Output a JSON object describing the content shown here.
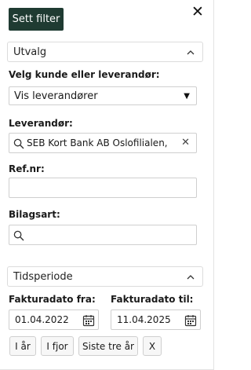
{
  "header": {
    "set_filter_label": "Sett filter",
    "close_label": "✕"
  },
  "utvalg": {
    "title": "Utvalg",
    "customer_or_supplier_label": "Velg kunde eller leverandør:",
    "customer_or_supplier_value": "Vis leverandører",
    "supplier_label": "Leverandør:",
    "supplier_value": "SEB Kort Bank AB Oslofilialen,",
    "refnr_label": "Ref.nr:",
    "refnr_value": "",
    "bilagsart_label": "Bilagsart:",
    "bilagsart_value": ""
  },
  "tidsperiode": {
    "title": "Tidsperiode",
    "from_label": "Fakturadato fra:",
    "from_value": "01.04.2022",
    "to_label": "Fakturadato til:",
    "to_value": "11.04.2025",
    "quick_buttons": [
      "I år",
      "I fjor",
      "Siste tre år",
      "X"
    ]
  },
  "icons": {
    "close": "close-icon",
    "chevron": "chevron-up-icon",
    "caret": "caret-down-icon",
    "search": "search-icon",
    "clear": "clear-icon",
    "calendar": "calendar-icon"
  },
  "colors": {
    "primary_button": "#1f3b32"
  }
}
